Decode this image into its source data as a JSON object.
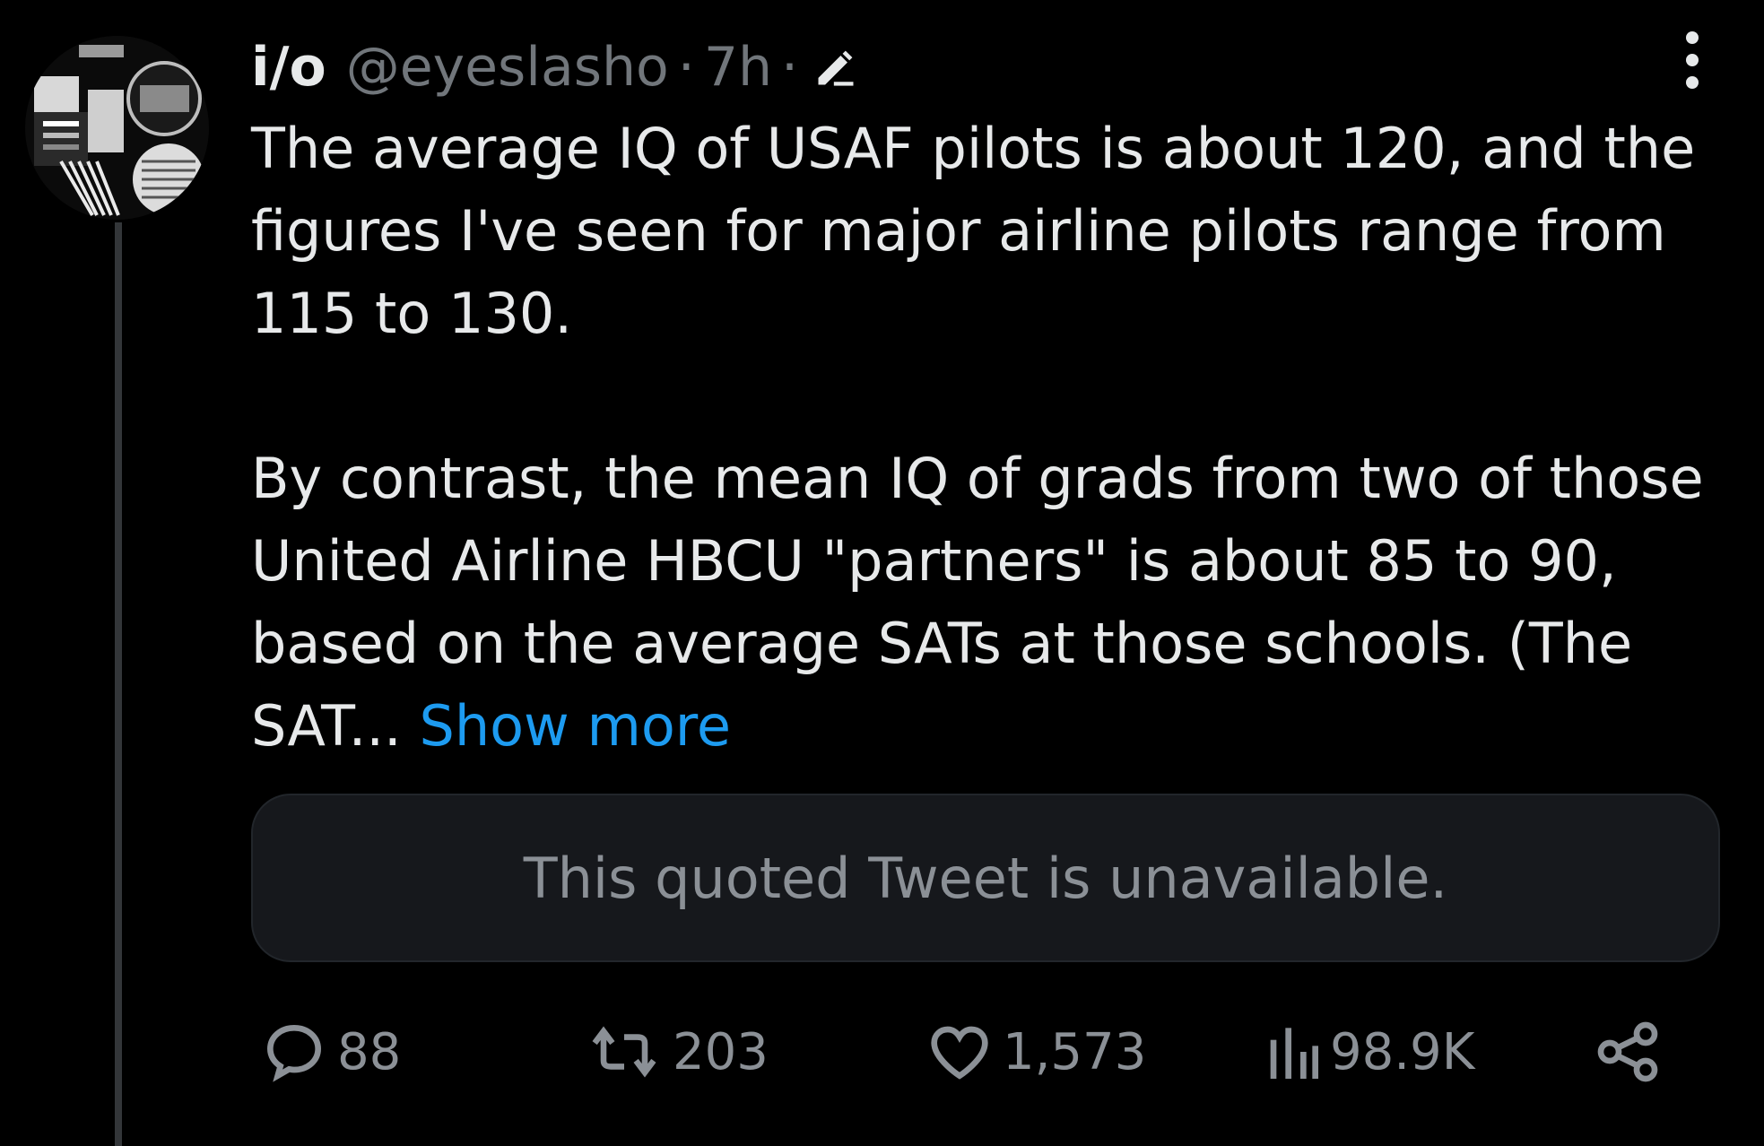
{
  "tweet": {
    "display_name": "i/o",
    "handle": "@eyeslasho",
    "separator": "·",
    "time": "7h",
    "separator2": "·",
    "paragraphs": [
      "The average IQ of USAF pilots is about 120, and the figures I've seen for major airline pilots range from 115 to 130.",
      "By contrast, the mean IQ of grads from two of those United Airline HBCU \"partners\" is about 85 to 90, based on the average SATs at those schools. (The SAT..."
    ],
    "show_more": "Show more",
    "quoted_unavailable": "This quoted Tweet is unavailable."
  },
  "actions": {
    "replies": "88",
    "retweets": "203",
    "likes": "1,573",
    "views": "98.9K"
  },
  "icons": {
    "edit": "pencil-icon",
    "more": "more-vertical-icon",
    "reply": "reply-icon",
    "retweet": "retweet-icon",
    "like": "heart-icon",
    "views": "views-chart-icon",
    "share": "share-icon"
  },
  "colors": {
    "background": "#000000",
    "text": "#e7e9ea",
    "muted": "#71767b",
    "link": "#1d9bf0"
  }
}
